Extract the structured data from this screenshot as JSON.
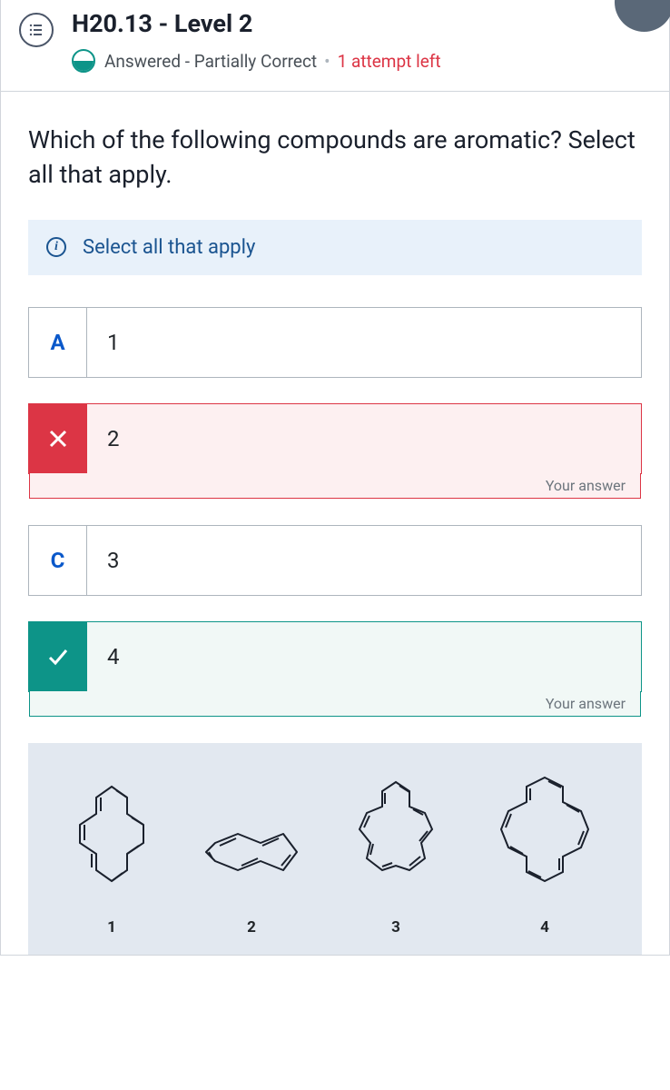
{
  "header": {
    "title": "H20.13 - Level 2",
    "status": "Answered - Partially Correct",
    "attempts": "1 attempt left"
  },
  "question": "Which of the following compounds are aromatic? Select all that apply.",
  "info": "Select all that apply",
  "options": [
    {
      "letter": "A",
      "label": "1",
      "state": "none"
    },
    {
      "letter": "X",
      "label": "2",
      "state": "incorrect",
      "tag": "Your answer"
    },
    {
      "letter": "C",
      "label": "3",
      "state": "none"
    },
    {
      "letter": "✓",
      "label": "4",
      "state": "correct",
      "tag": "Your answer"
    }
  ],
  "compounds": [
    {
      "label": "1"
    },
    {
      "label": "2"
    },
    {
      "label": "3"
    },
    {
      "label": "4"
    }
  ]
}
